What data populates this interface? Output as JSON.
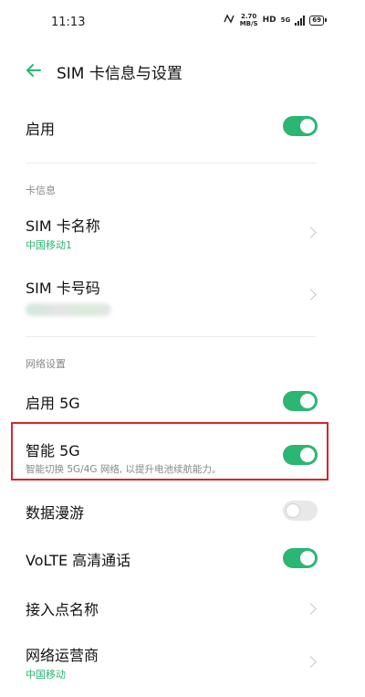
{
  "status_bar": {
    "time": "11:13",
    "net_speed_value": "2.70",
    "net_speed_unit": "MB/S",
    "hd": "HD",
    "signal_label": "5G",
    "battery": "69"
  },
  "header": {
    "title": "SIM 卡信息与设置"
  },
  "rows": {
    "enable": {
      "label": "启用",
      "toggle": "on"
    },
    "card_info_section": "卡信息",
    "sim_name": {
      "label": "SIM 卡名称",
      "value": "中国移动1"
    },
    "sim_number": {
      "label": "SIM 卡号码"
    },
    "network_section": "网络设置",
    "enable_5g": {
      "label": "启用 5G",
      "toggle": "on"
    },
    "smart_5g": {
      "label": "智能 5G",
      "description": "智能切换 5G/4G 网络, 以提升电池续航能力。",
      "toggle": "on"
    },
    "data_roaming": {
      "label": "数据漫游",
      "toggle": "off"
    },
    "volte": {
      "label": "VoLTE 高清通话",
      "toggle": "on"
    },
    "apn": {
      "label": "接入点名称"
    },
    "operator": {
      "label": "网络运营商",
      "value": "中国移动"
    }
  },
  "colors": {
    "accent": "#2bb673",
    "highlight_border": "#d9252a"
  }
}
